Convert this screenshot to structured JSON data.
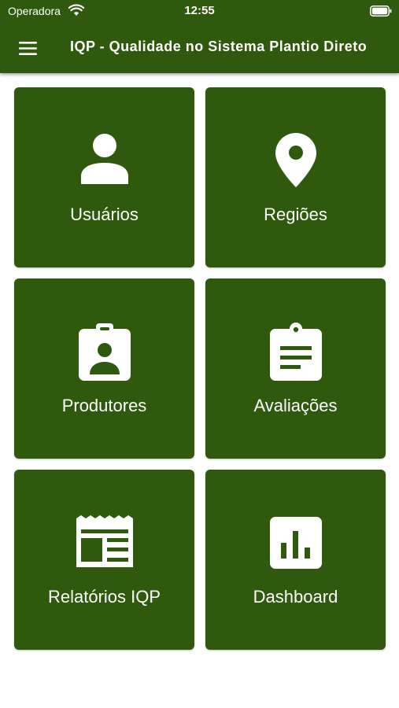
{
  "status_bar": {
    "carrier": "Operadora",
    "time": "12:55",
    "wifi_icon": "wifi-icon",
    "battery_icon": "battery-icon"
  },
  "app_bar": {
    "title": "IQP - Qualidade no Sistema Plantio Direto",
    "menu_icon": "hamburger-menu-icon",
    "background": "#2f5a0e"
  },
  "tiles": [
    {
      "label": "Usuários",
      "icon": "user-icon"
    },
    {
      "label": "Regiões",
      "icon": "map-pin-icon"
    },
    {
      "label": "Produtores",
      "icon": "id-badge-icon"
    },
    {
      "label": "Avaliações",
      "icon": "clipboard-icon"
    },
    {
      "label": "Relatórios IQP",
      "icon": "receipt-icon"
    },
    {
      "label": "Dashboard",
      "icon": "bar-chart-icon"
    }
  ],
  "colors": {
    "primary": "#2f5a0e",
    "text_on_primary": "#ffffff",
    "background": "#ffffff"
  }
}
